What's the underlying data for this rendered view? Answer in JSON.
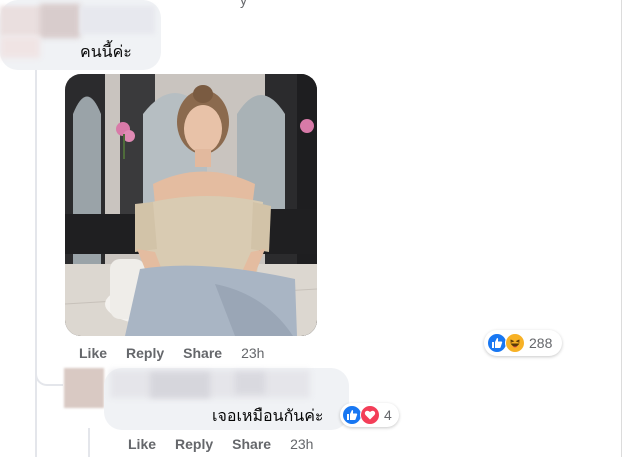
{
  "top_fragment": "y",
  "comment1": {
    "text": "คนนี้ค่ะ",
    "actions": {
      "like": "Like",
      "reply": "Reply",
      "share": "Share",
      "time": "23h"
    },
    "reactions": {
      "icons": [
        "like-icon",
        "haha-icon"
      ],
      "count": "288"
    }
  },
  "comment2": {
    "text": "เจอเหมือนกันค่ะ",
    "actions": {
      "like": "Like",
      "reply": "Reply",
      "share": "Share",
      "time": "23h"
    },
    "reactions": {
      "icons": [
        "like-icon",
        "love-icon"
      ],
      "count": "4"
    }
  },
  "colors": {
    "like": "#1877f2",
    "haha": "#f7b125",
    "love": "#f33e58",
    "bubble": "#f0f2f5",
    "meta": "#65676b"
  }
}
